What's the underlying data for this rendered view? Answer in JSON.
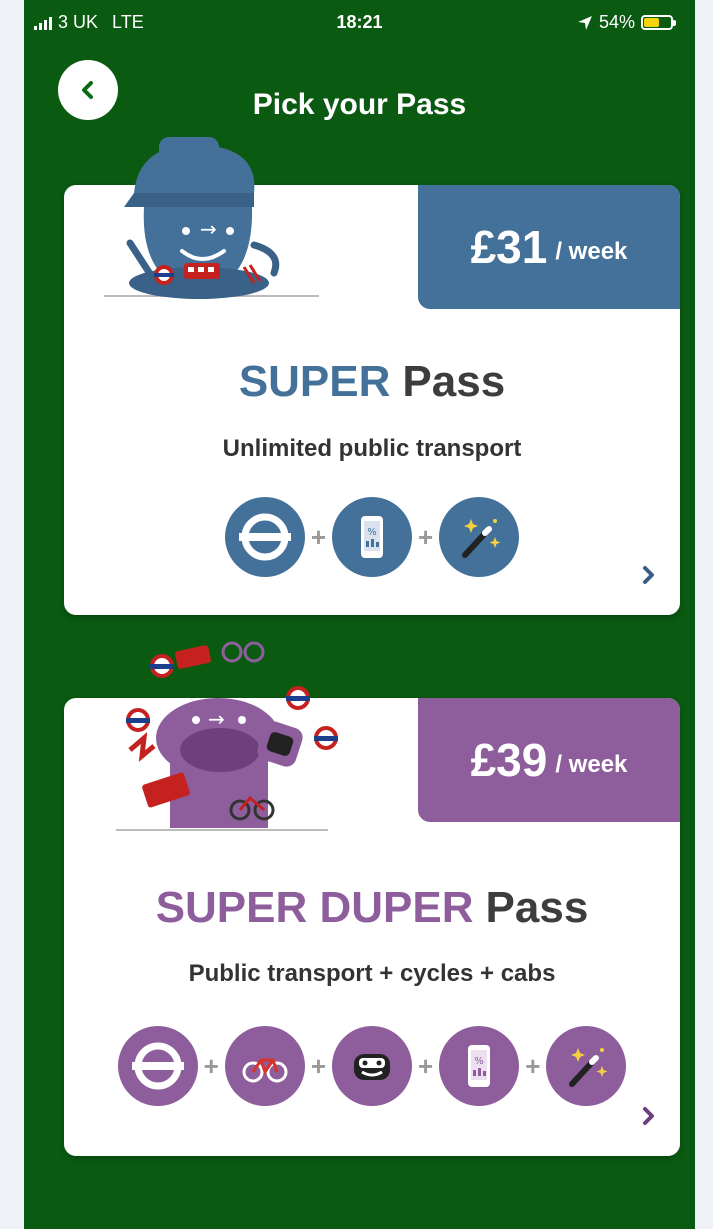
{
  "status": {
    "carrier": "3 UK",
    "network": "LTE",
    "time": "18:21",
    "battery": "54%"
  },
  "header": {
    "title": "Pick your Pass"
  },
  "colors": {
    "super": "#44719a",
    "duper": "#8e5e9c",
    "background": "#0a5a12"
  },
  "passes": [
    {
      "price": "£31",
      "period": "/ week",
      "name_highlight": "SUPER",
      "name_rest": "Pass",
      "description": "Unlimited public transport",
      "icons": [
        "underground-icon",
        "phone-discount-icon",
        "magic-wand-icon"
      ]
    },
    {
      "price": "£39",
      "period": "/ week",
      "name_highlight": "SUPER DUPER",
      "name_rest": "Pass",
      "description": "Public transport + cycles + cabs",
      "icons": [
        "underground-icon",
        "bicycle-icon",
        "cab-icon",
        "phone-discount-icon",
        "magic-wand-icon"
      ]
    }
  ]
}
